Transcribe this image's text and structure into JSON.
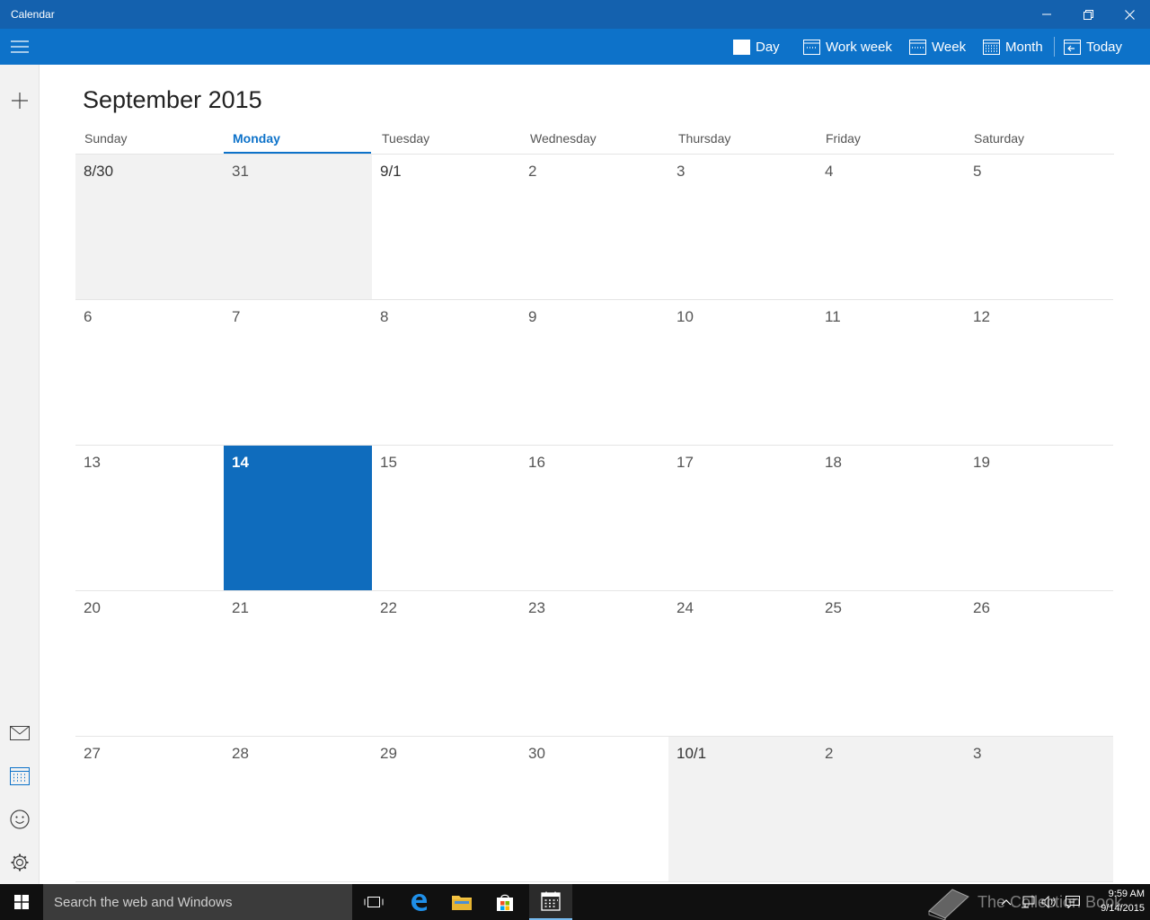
{
  "window": {
    "title": "Calendar"
  },
  "toolbar": {
    "views": [
      {
        "label": "Day",
        "icon": "calendar-day-icon"
      },
      {
        "label": "Work week",
        "icon": "calendar-workweek-icon"
      },
      {
        "label": "Week",
        "icon": "calendar-week-icon"
      },
      {
        "label": "Month",
        "icon": "calendar-month-icon"
      },
      {
        "label": "Today",
        "icon": "calendar-today-icon"
      }
    ]
  },
  "calendar": {
    "month_title": "September 2015",
    "weekdays": [
      "Sunday",
      "Monday",
      "Tuesday",
      "Wednesday",
      "Thursday",
      "Friday",
      "Saturday"
    ],
    "today_weekday": "Monday",
    "weeks": [
      [
        "8/30",
        "31",
        "9/1",
        "2",
        "3",
        "4",
        "5"
      ],
      [
        "6",
        "7",
        "8",
        "9",
        "10",
        "11",
        "12"
      ],
      [
        "13",
        "14",
        "15",
        "16",
        "17",
        "18",
        "19"
      ],
      [
        "20",
        "21",
        "22",
        "23",
        "24",
        "25",
        "26"
      ],
      [
        "27",
        "28",
        "29",
        "30",
        "10/1",
        "2",
        "3"
      ]
    ],
    "today_day": "14"
  },
  "taskbar": {
    "search_placeholder": "Search the web and Windows",
    "watermark_text": "The Collection Book",
    "clock_time": "9:59 AM",
    "clock_date": "9/14/2015"
  },
  "colors": {
    "titlebar": "#1461ae",
    "toolbar": "#0d72c9",
    "today_cell": "#0f6cbd",
    "other_month_cell": "#f2f2f2"
  }
}
